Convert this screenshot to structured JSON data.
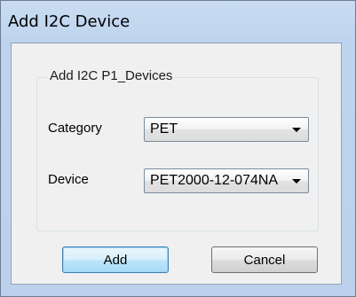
{
  "window": {
    "title": "Add I2C Device"
  },
  "group": {
    "legend": "Add I2C P1_Devices"
  },
  "category": {
    "label": "Category",
    "value": "PET",
    "icon": "chevron-down-icon"
  },
  "device": {
    "label": "Device",
    "value": "PET2000-12-074NA",
    "icon": "chevron-down-icon"
  },
  "buttons": {
    "add_label": "Add",
    "cancel_label": "Cancel"
  },
  "colors": {
    "title_bar": "#bed4ee",
    "client_background": "#f0f0f0",
    "default_button_border": "#3c7fb1"
  }
}
